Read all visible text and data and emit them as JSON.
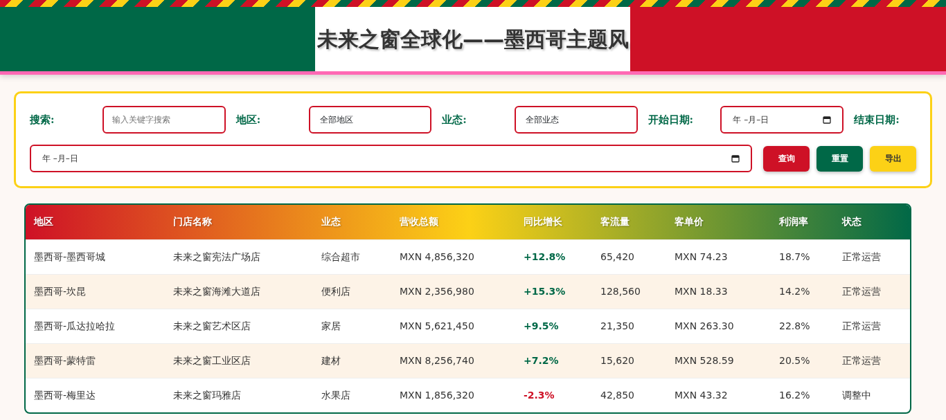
{
  "header": {
    "title": "未来之窗全球化——墨西哥主题风"
  },
  "filters": {
    "search": {
      "label": "搜索:",
      "placeholder": "输入关键字搜索"
    },
    "region": {
      "label": "地区:",
      "value": "全部地区"
    },
    "format": {
      "label": "业态:",
      "value": "全部业态"
    },
    "start_date": {
      "label": "开始日期:",
      "value": "年 –月–日"
    },
    "end_date": {
      "label": "结束日期:",
      "value": "年 –月–日"
    },
    "buttons": [
      {
        "label": "查询",
        "kind": "primary"
      },
      {
        "label": "重置",
        "kind": "secondary"
      },
      {
        "label": "导出",
        "kind": "export"
      }
    ]
  },
  "table": {
    "columns": [
      "地区",
      "门店名称",
      "业态",
      "营收总额",
      "同比增长",
      "客流量",
      "客单价",
      "利润率",
      "状态"
    ],
    "rows": [
      {
        "cells": [
          "墨西哥-墨西哥城",
          "未来之窗宪法广场店",
          "综合超市",
          "MXN 4,856,320",
          "+12.8%",
          "65,420",
          "MXN 74.23",
          "18.7%",
          "正常运营"
        ],
        "color": "#006847"
      },
      {
        "cells": [
          "墨西哥-坎昆",
          "未来之窗海滩大道店",
          "便利店",
          "MXN 2,356,980",
          "+15.3%",
          "128,560",
          "MXN 18.33",
          "14.2%",
          "正常运营"
        ],
        "color": "#006847"
      },
      {
        "cells": [
          "墨西哥-瓜达拉哈拉",
          "未来之窗艺术区店",
          "家居",
          "MXN 5,621,450",
          "+9.5%",
          "21,350",
          "MXN 263.30",
          "22.8%",
          "正常运营"
        ],
        "color": "#006847"
      },
      {
        "cells": [
          "墨西哥-蒙特雷",
          "未来之窗工业区店",
          "建材",
          "MXN 8,256,740",
          "+7.2%",
          "15,620",
          "MXN 528.59",
          "20.5%",
          "正常运营"
        ],
        "color": "#006847"
      },
      {
        "cells": [
          "墨西哥-梅里达",
          "未来之窗玛雅店",
          "水果店",
          "MXN 1,856,320",
          "-2.3%",
          "42,850",
          "MXN 43.32",
          "16.2%",
          "调整中"
        ],
        "color": "#ce1126"
      }
    ]
  }
}
